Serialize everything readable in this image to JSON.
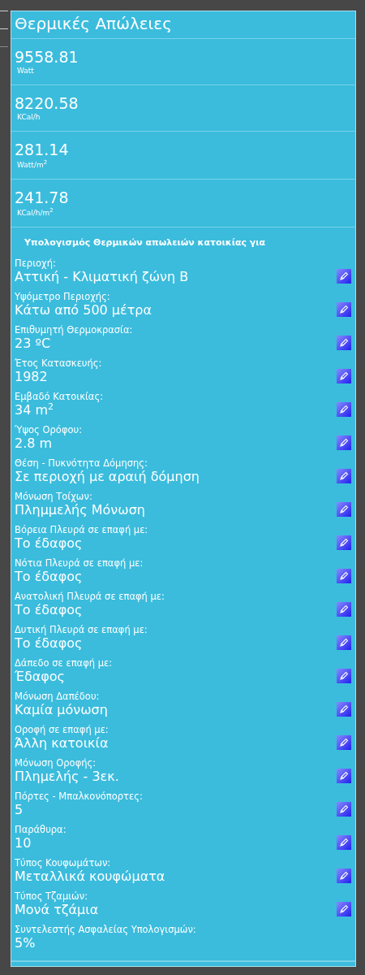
{
  "title": "Θερμικές Απώλειες",
  "results": [
    {
      "value": "9558.81",
      "unit": "Watt"
    },
    {
      "value": "8220.58",
      "unit": "KCal/h"
    },
    {
      "value": "281.14",
      "unit": "Watt/m$^{2}$"
    },
    {
      "value": "241.78",
      "unit": "KCal/h/m$^{2}$"
    }
  ],
  "section_heading": "Υπολογισμός Θερμικών απωλειών κατοικίας για",
  "fields": [
    {
      "label": "Περιοχή:",
      "value": "Αττική - Κλιματική ζώνη Β",
      "editable": true
    },
    {
      "label": "Υψόμετρο Περιοχής:",
      "value": "Κάτω από 500 μέτρα",
      "editable": true
    },
    {
      "label": "Επιθυμητή Θερμοκρασία:",
      "value": "23 ºC",
      "editable": true
    },
    {
      "label": "Έτος Κατασκευής:",
      "value": "1982",
      "editable": true
    },
    {
      "label": "Εμβαδό Κατοικίας:",
      "value": "34 m$^{2}$",
      "editable": true
    },
    {
      "label": "Ύψος Ορόφου:",
      "value": "2.8 m",
      "editable": true
    },
    {
      "label": "Θέση - Πυκνότητα Δόμησης:",
      "value": "Σε περιοχή με αραιή δόμηση",
      "editable": true
    },
    {
      "label": "Μόνωση Τοίχων:",
      "value": "Πλημμελής Μόνωση",
      "editable": true
    },
    {
      "label": "Βόρεια Πλευρά σε επαφή με:",
      "value": "Το έδαφος",
      "editable": true
    },
    {
      "label": "Νότια Πλευρά σε επαφή με:",
      "value": "Το έδαφος",
      "editable": true
    },
    {
      "label": "Ανατολική Πλευρά σε επαφή με:",
      "value": "Το έδαφος",
      "editable": true
    },
    {
      "label": "Δυτική Πλευρά σε επαφή με:",
      "value": "Το έδαφος",
      "editable": true
    },
    {
      "label": "Δάπεδο σε επαφή με:",
      "value": "Έδαφος",
      "editable": true
    },
    {
      "label": "Μόνωση Δαπέδου:",
      "value": "Καμία μόνωση",
      "editable": true
    },
    {
      "label": "Οροφή σε επαφή με:",
      "value": "Άλλη κατοικία",
      "editable": true
    },
    {
      "label": "Μόνωση Οροφής:",
      "value": "Πλημελής - 3εκ.",
      "editable": true
    },
    {
      "label": "Πόρτες - Μπαλκονόπορτες:",
      "value": "5",
      "editable": true
    },
    {
      "label": "Παράθυρα:",
      "value": "10",
      "editable": true
    },
    {
      "label": "Τύπος Κουφωμάτων:",
      "value": "Μεταλλικά κουφώματα",
      "editable": true
    },
    {
      "label": "Τύπος Τζαμιών:",
      "value": "Μονά τζάμια",
      "editable": true
    },
    {
      "label": "Συντελεστής Ασφαλείας Υπολογισμών:",
      "value": "5%",
      "editable": false
    }
  ]
}
